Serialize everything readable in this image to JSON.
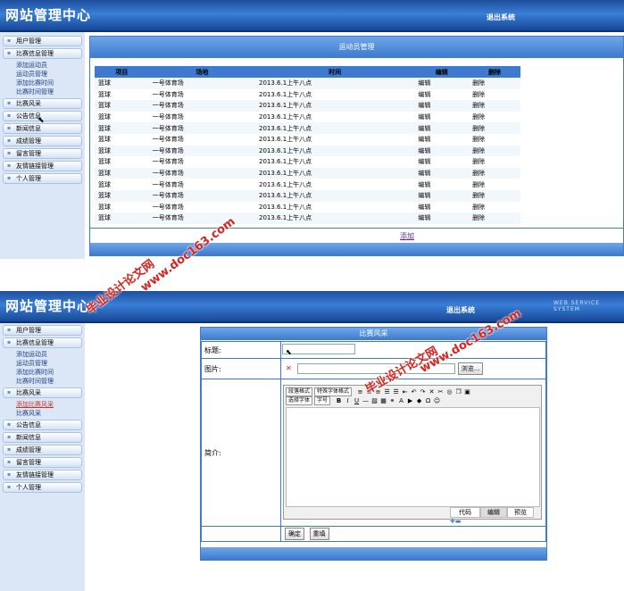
{
  "app": {
    "title": "网站管理中心",
    "logout": "退出系统",
    "ws_label": "WEB SERVICE SYSTEM"
  },
  "screen1": {
    "sidebar": {
      "items": [
        "用户管理",
        "比赛信息管理"
      ],
      "subs": [
        "添加运动员",
        "运动员管理",
        "添加比赛时间",
        "比赛时间管理"
      ],
      "items2": [
        "比赛风采",
        "公告信息",
        "新闻信息",
        "成绩管理",
        "留言管理",
        "友情链接管理",
        "个人管理"
      ]
    },
    "title": "运动员管理",
    "columns": [
      "项目",
      "场地",
      "时间",
      "编辑",
      "删除"
    ],
    "rows": [
      [
        "篮球",
        "一号体育场",
        "2013.6.1上午八点",
        "编辑",
        "删除"
      ],
      [
        "篮球",
        "一号体育场",
        "2013.6.1上午八点",
        "编辑",
        "删除"
      ],
      [
        "篮球",
        "一号体育场",
        "2013.6.1上午八点",
        "编辑",
        "删除"
      ],
      [
        "篮球",
        "一号体育场",
        "2013.6.1上午八点",
        "编辑",
        "删除"
      ],
      [
        "篮球",
        "一号体育场",
        "2013.6.1上午八点",
        "编辑",
        "删除"
      ],
      [
        "篮球",
        "一号体育场",
        "2013.6.1上午八点",
        "编辑",
        "删除"
      ],
      [
        "篮球",
        "一号体育场",
        "2013.6.1上午八点",
        "编辑",
        "删除"
      ],
      [
        "篮球",
        "一号体育场",
        "2013.6.1上午八点",
        "编辑",
        "删除"
      ],
      [
        "篮球",
        "一号体育场",
        "2013.6.1上午八点",
        "编辑",
        "删除"
      ],
      [
        "篮球",
        "一号体育场",
        "2013.6.1上午八点",
        "编辑",
        "删除"
      ],
      [
        "篮球",
        "一号体育场",
        "2013.6.1上午八点",
        "编辑",
        "删除"
      ],
      [
        "篮球",
        "一号体育场",
        "2013.6.1上午八点",
        "编辑",
        "删除"
      ],
      [
        "篮球",
        "一号体育场",
        "2013.6.1上午八点",
        "编辑",
        "删除"
      ]
    ],
    "add_link": "添加"
  },
  "screen2": {
    "sidebar": {
      "items": [
        "用户管理",
        "比赛信息管理"
      ],
      "subs": [
        "添加运动员",
        "运动员管理",
        "添加比赛时间",
        "比赛时间管理"
      ],
      "item_fc": "比赛风采",
      "subs2": [
        "添加比赛风采",
        "比赛风采"
      ],
      "items2": [
        "公告信息",
        "新闻信息",
        "成绩管理",
        "留言管理",
        "友情链接管理",
        "个人管理"
      ]
    },
    "title": "比赛风采",
    "label_title": "标题:",
    "label_image": "图片:",
    "label_intro": "简介:",
    "browse": "浏览...",
    "editor": {
      "select1": "段落格式",
      "select2": "特殊字体格式",
      "select3": "选择字体",
      "select4": "字号",
      "tabs": [
        "代码",
        "编辑",
        "预览"
      ]
    },
    "btn_ok": "确定",
    "btn_reset": "重填"
  },
  "watermark": {
    "text1": "毕业设计论文网",
    "text2": "www.doc163.com"
  },
  "colors": {
    "accent": "#3d7ad0",
    "header": "#1d4e9a",
    "watermark": "#d8231f",
    "sidebar": "#dbe7f6"
  }
}
